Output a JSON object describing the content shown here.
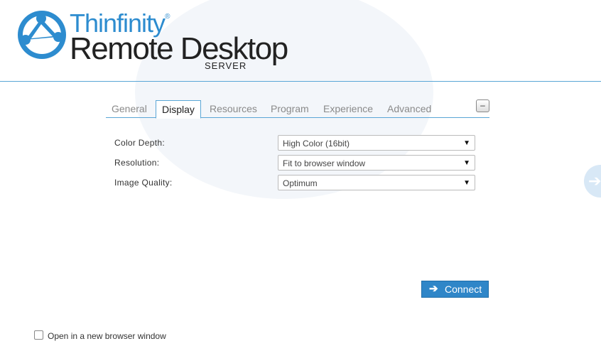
{
  "brand": {
    "top": "Thinfinity",
    "registered": "®",
    "main": "Remote Desktop",
    "sub": "SERVER"
  },
  "tabs": [
    {
      "label": "General",
      "active": false
    },
    {
      "label": "Display",
      "active": true
    },
    {
      "label": "Resources",
      "active": false
    },
    {
      "label": "Program",
      "active": false
    },
    {
      "label": "Experience",
      "active": false
    },
    {
      "label": "Advanced",
      "active": false
    }
  ],
  "collapse": {
    "symbol": "–"
  },
  "display": {
    "color_depth": {
      "label": "Color Depth:",
      "value": "High Color (16bit)"
    },
    "resolution": {
      "label": "Resolution:",
      "value": "Fit to browser window"
    },
    "image_quality": {
      "label": "Image Quality:",
      "value": "Optimum"
    }
  },
  "connect": {
    "label": "Connect",
    "icon": "arrow-right-icon"
  },
  "new_window": {
    "label": "Open in a new browser window",
    "checked": false
  },
  "colors": {
    "accent": "#2f86c8",
    "brand_blue": "#2d8ccf",
    "border": "#5aa6d6"
  }
}
